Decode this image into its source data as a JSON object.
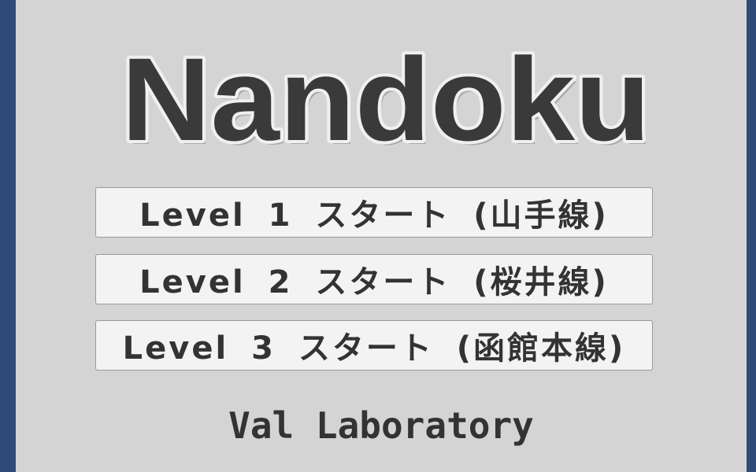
{
  "title": {
    "text": "Nandoku"
  },
  "menu": {
    "levels": [
      {
        "label": "Level 1 スタート (山手線)"
      },
      {
        "label": "Level 2 スタート (桜井線)"
      },
      {
        "label": "Level 3 スタート (函館本線)"
      }
    ]
  },
  "credit": {
    "text": "Val Laboratory"
  },
  "colors": {
    "frame": "#2e4a78",
    "background": "#d4d4d4",
    "logo_fill": "#3a3a3a",
    "logo_outline": "#f0f0f0",
    "button_fill": "#f3f3f3",
    "text": "#333333"
  }
}
